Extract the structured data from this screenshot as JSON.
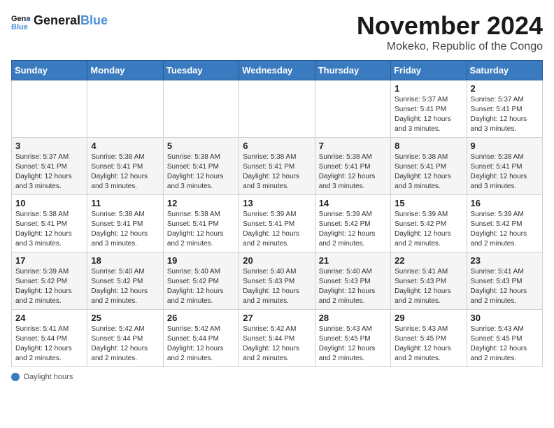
{
  "header": {
    "logo_general": "General",
    "logo_blue": "Blue",
    "month": "November 2024",
    "location": "Mokeko, Republic of the Congo"
  },
  "days_of_week": [
    "Sunday",
    "Monday",
    "Tuesday",
    "Wednesday",
    "Thursday",
    "Friday",
    "Saturday"
  ],
  "footer": {
    "daylight_label": "Daylight hours"
  },
  "weeks": [
    [
      {
        "day": "",
        "info": ""
      },
      {
        "day": "",
        "info": ""
      },
      {
        "day": "",
        "info": ""
      },
      {
        "day": "",
        "info": ""
      },
      {
        "day": "",
        "info": ""
      },
      {
        "day": "1",
        "info": "Sunrise: 5:37 AM\nSunset: 5:41 PM\nDaylight: 12 hours and 3 minutes."
      },
      {
        "day": "2",
        "info": "Sunrise: 5:37 AM\nSunset: 5:41 PM\nDaylight: 12 hours and 3 minutes."
      }
    ],
    [
      {
        "day": "3",
        "info": "Sunrise: 5:37 AM\nSunset: 5:41 PM\nDaylight: 12 hours and 3 minutes."
      },
      {
        "day": "4",
        "info": "Sunrise: 5:38 AM\nSunset: 5:41 PM\nDaylight: 12 hours and 3 minutes."
      },
      {
        "day": "5",
        "info": "Sunrise: 5:38 AM\nSunset: 5:41 PM\nDaylight: 12 hours and 3 minutes."
      },
      {
        "day": "6",
        "info": "Sunrise: 5:38 AM\nSunset: 5:41 PM\nDaylight: 12 hours and 3 minutes."
      },
      {
        "day": "7",
        "info": "Sunrise: 5:38 AM\nSunset: 5:41 PM\nDaylight: 12 hours and 3 minutes."
      },
      {
        "day": "8",
        "info": "Sunrise: 5:38 AM\nSunset: 5:41 PM\nDaylight: 12 hours and 3 minutes."
      },
      {
        "day": "9",
        "info": "Sunrise: 5:38 AM\nSunset: 5:41 PM\nDaylight: 12 hours and 3 minutes."
      }
    ],
    [
      {
        "day": "10",
        "info": "Sunrise: 5:38 AM\nSunset: 5:41 PM\nDaylight: 12 hours and 3 minutes."
      },
      {
        "day": "11",
        "info": "Sunrise: 5:38 AM\nSunset: 5:41 PM\nDaylight: 12 hours and 3 minutes."
      },
      {
        "day": "12",
        "info": "Sunrise: 5:38 AM\nSunset: 5:41 PM\nDaylight: 12 hours and 2 minutes."
      },
      {
        "day": "13",
        "info": "Sunrise: 5:39 AM\nSunset: 5:41 PM\nDaylight: 12 hours and 2 minutes."
      },
      {
        "day": "14",
        "info": "Sunrise: 5:39 AM\nSunset: 5:42 PM\nDaylight: 12 hours and 2 minutes."
      },
      {
        "day": "15",
        "info": "Sunrise: 5:39 AM\nSunset: 5:42 PM\nDaylight: 12 hours and 2 minutes."
      },
      {
        "day": "16",
        "info": "Sunrise: 5:39 AM\nSunset: 5:42 PM\nDaylight: 12 hours and 2 minutes."
      }
    ],
    [
      {
        "day": "17",
        "info": "Sunrise: 5:39 AM\nSunset: 5:42 PM\nDaylight: 12 hours and 2 minutes."
      },
      {
        "day": "18",
        "info": "Sunrise: 5:40 AM\nSunset: 5:42 PM\nDaylight: 12 hours and 2 minutes."
      },
      {
        "day": "19",
        "info": "Sunrise: 5:40 AM\nSunset: 5:42 PM\nDaylight: 12 hours and 2 minutes."
      },
      {
        "day": "20",
        "info": "Sunrise: 5:40 AM\nSunset: 5:43 PM\nDaylight: 12 hours and 2 minutes."
      },
      {
        "day": "21",
        "info": "Sunrise: 5:40 AM\nSunset: 5:43 PM\nDaylight: 12 hours and 2 minutes."
      },
      {
        "day": "22",
        "info": "Sunrise: 5:41 AM\nSunset: 5:43 PM\nDaylight: 12 hours and 2 minutes."
      },
      {
        "day": "23",
        "info": "Sunrise: 5:41 AM\nSunset: 5:43 PM\nDaylight: 12 hours and 2 minutes."
      }
    ],
    [
      {
        "day": "24",
        "info": "Sunrise: 5:41 AM\nSunset: 5:44 PM\nDaylight: 12 hours and 2 minutes."
      },
      {
        "day": "25",
        "info": "Sunrise: 5:42 AM\nSunset: 5:44 PM\nDaylight: 12 hours and 2 minutes."
      },
      {
        "day": "26",
        "info": "Sunrise: 5:42 AM\nSunset: 5:44 PM\nDaylight: 12 hours and 2 minutes."
      },
      {
        "day": "27",
        "info": "Sunrise: 5:42 AM\nSunset: 5:44 PM\nDaylight: 12 hours and 2 minutes."
      },
      {
        "day": "28",
        "info": "Sunrise: 5:43 AM\nSunset: 5:45 PM\nDaylight: 12 hours and 2 minutes."
      },
      {
        "day": "29",
        "info": "Sunrise: 5:43 AM\nSunset: 5:45 PM\nDaylight: 12 hours and 2 minutes."
      },
      {
        "day": "30",
        "info": "Sunrise: 5:43 AM\nSunset: 5:45 PM\nDaylight: 12 hours and 2 minutes."
      }
    ]
  ]
}
